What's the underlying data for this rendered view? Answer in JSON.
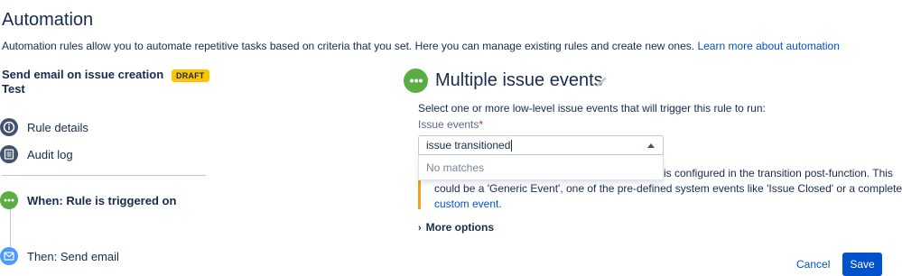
{
  "page": {
    "title": "Automation",
    "description": "Automation rules allow you to automate repetitive tasks based on criteria that you set. Here you can manage existing rules and create new ones.",
    "learn_more_link": "Learn more about automation"
  },
  "rule": {
    "name": "Send email on issue creation Test",
    "status_badge": "DRAFT"
  },
  "sidebar": {
    "items": [
      {
        "label": "Rule details",
        "icon": "info-icon"
      },
      {
        "label": "Audit log",
        "icon": "list-icon"
      }
    ],
    "steps": [
      {
        "label": "When: Rule is triggered on",
        "icon": "more-icon",
        "color": "#5aac44"
      },
      {
        "label": "Then: Send email",
        "icon": "mail-icon",
        "color": "#4c9aff"
      }
    ]
  },
  "trigger": {
    "title": "Multiple issue events",
    "instructions": "Select one or more low-level issue events that will trigger this rule to run:",
    "field_label": "Issue events",
    "required_marker": "*",
    "input_value": "issue transitioned",
    "dropdown_empty": "No matches",
    "warning_lines": [
      "is configured in the transition post-function. This",
      "could be a 'Generic Event', one of the pre-defined system events like 'Issue Closed' or a completely"
    ],
    "warning_link": "custom event.",
    "more_options": "More options"
  },
  "actions": {
    "cancel": "Cancel",
    "save": "Save"
  },
  "colors": {
    "accent": "#0052cc",
    "draft": "#ffc400",
    "trigger_green": "#5aac44",
    "warning": "#ff991f"
  }
}
